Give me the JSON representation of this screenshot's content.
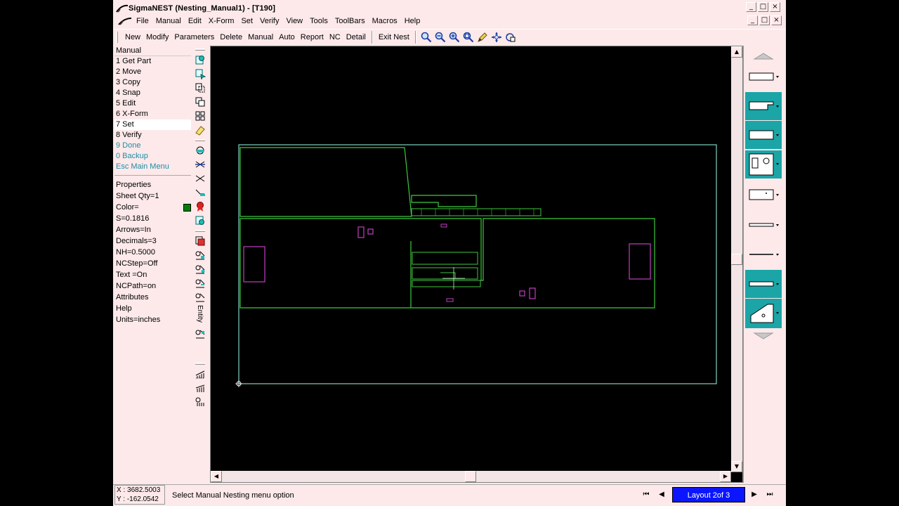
{
  "window": {
    "title": "SigmaNEST   (Nesting_Manual1) - [T190]",
    "controls": [
      "_",
      "□",
      "×"
    ]
  },
  "menubar": {
    "items": [
      "File",
      "Manual",
      "Edit",
      "X-Form",
      "Set",
      "Verify",
      "View",
      "Tools",
      "ToolBars",
      "Macros",
      "Help"
    ]
  },
  "toolbar": {
    "buttons": [
      "New",
      "Modify",
      "Parameters",
      "Delete",
      "Manual",
      "Auto",
      "Report",
      "NC",
      "Detail"
    ],
    "exit_label": "Exit Nest",
    "icons": [
      "zoom-icon",
      "zoom-out-icon",
      "zoom-in-icon",
      "zoom-window-icon",
      "pencil-icon",
      "pan-icon",
      "rotate-view-icon"
    ]
  },
  "manual_menu": {
    "header": "Manual",
    "items": [
      {
        "label": "1 Get Part",
        "selected": false,
        "link": false
      },
      {
        "label": "2 Move",
        "selected": false,
        "link": false
      },
      {
        "label": "3 Copy",
        "selected": false,
        "link": false
      },
      {
        "label": "4 Snap",
        "selected": false,
        "link": false
      },
      {
        "label": "5 Edit",
        "selected": false,
        "link": false
      },
      {
        "label": "6 X-Form",
        "selected": false,
        "link": false
      },
      {
        "label": "7 Set",
        "selected": true,
        "link": false
      },
      {
        "label": "8 Verify",
        "selected": false,
        "link": false
      },
      {
        "label": "9 Done",
        "selected": false,
        "link": true
      },
      {
        "label": "0 Backup",
        "selected": false,
        "link": true
      },
      {
        "label": "Esc Main Menu",
        "selected": false,
        "link": true
      }
    ]
  },
  "properties": {
    "items": [
      "Properties",
      "Sheet Qty=1",
      "Color=",
      "S=0.1816",
      "Arrows=In",
      "Decimals=3",
      "NH=0.5000",
      "NCStep=Off",
      "Text  =On",
      "NCPath=on",
      "Attributes",
      "Help",
      "Units=inches"
    ],
    "color_swatch": "#008000"
  },
  "vstrip": {
    "entity_label": "Entity"
  },
  "canvas": {
    "sheet_color": "#7fd3c0",
    "part_color": "#3ec93e",
    "hole_color": "#c040c0"
  },
  "status": {
    "x": "X : 3682.5003",
    "y": "Y : -162.0542",
    "message": "Select Manual Nesting menu option",
    "layout_label": "Layout 2of 3",
    "nav": [
      "⏮",
      "◀",
      "▶",
      "⏭"
    ]
  }
}
